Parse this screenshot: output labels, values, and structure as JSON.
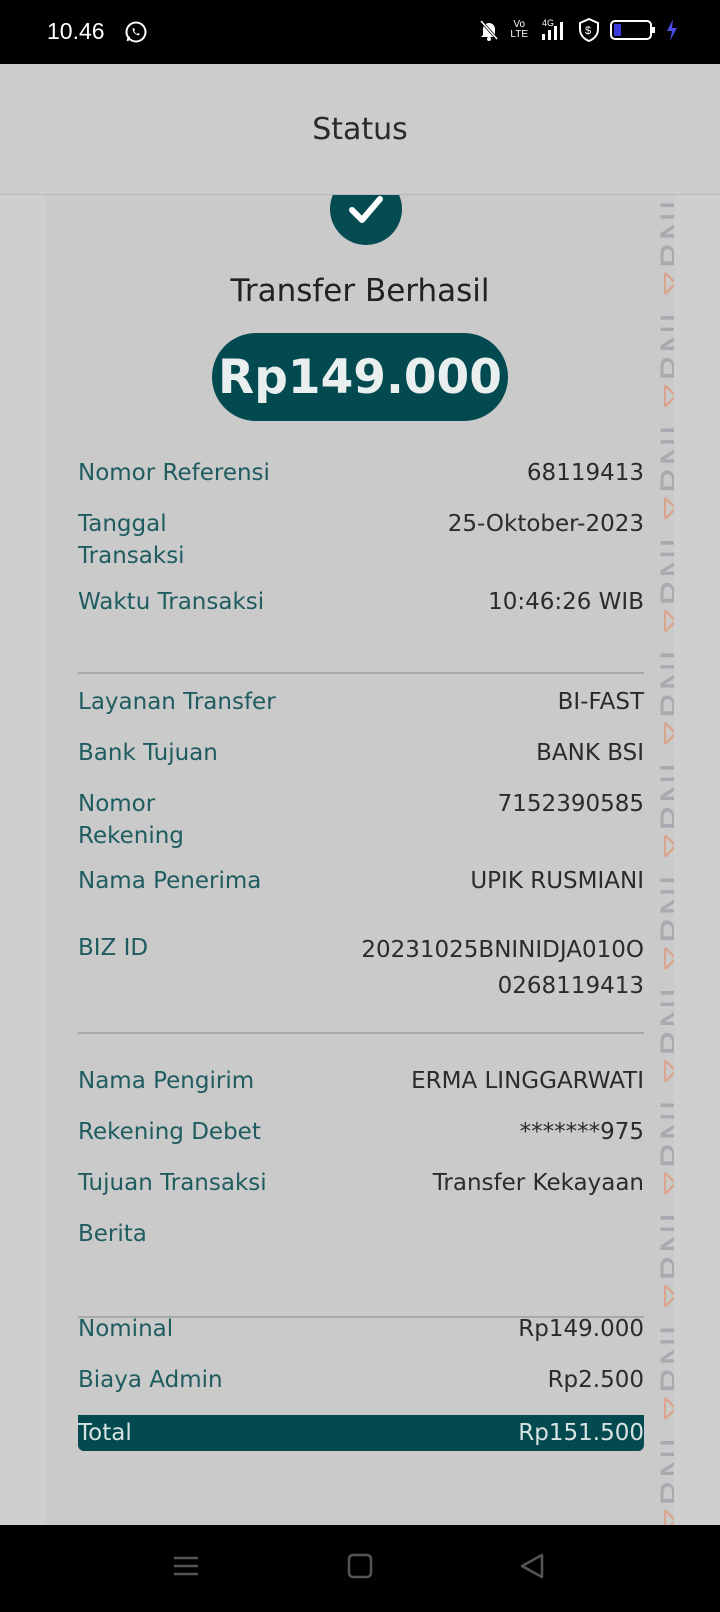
{
  "status_bar": {
    "time": "10.46",
    "icons": [
      "whatsapp-icon",
      "mute-icon",
      "volte-icon",
      "signal-4g-icon",
      "vpn-shield-icon",
      "battery-icon",
      "charging-icon"
    ],
    "volte_text": "Vo\nLTE",
    "network_text": "4G"
  },
  "header": {
    "title": "Status"
  },
  "receipt": {
    "status_title": "Transfer Berhasil",
    "amount": "Rp149.000",
    "watermark_text": "BNI",
    "section1": [
      {
        "label": "Nomor Referensi",
        "value": "68119413"
      },
      {
        "label": "Tanggal Transaksi",
        "value": "25-Oktober-2023"
      },
      {
        "label": "Waktu Transaksi",
        "value": "10:46:26 WIB"
      }
    ],
    "section2": [
      {
        "label": "Layanan Transfer",
        "value": "BI-FAST"
      },
      {
        "label": "Bank Tujuan",
        "value": "BANK BSI"
      },
      {
        "label": "Nomor Rekening",
        "value": "7152390585"
      },
      {
        "label": "Nama Penerima",
        "value": "UPIK RUSMIANI"
      },
      {
        "label": "BIZ ID",
        "value": "20231025BNINIDJA010O0268119413"
      }
    ],
    "section3": [
      {
        "label": "Nama Pengirim",
        "value": "ERMA LINGGARWATI"
      },
      {
        "label": "Rekening Debet",
        "value": "*******975"
      },
      {
        "label": "Tujuan Transaksi",
        "value": "Transfer Kekayaan"
      },
      {
        "label": "Berita",
        "value": ""
      }
    ],
    "section4": [
      {
        "label": "Nominal",
        "value": "Rp149.000"
      },
      {
        "label": "Biaya Admin",
        "value": "Rp2.500"
      }
    ],
    "total": {
      "label": "Total",
      "value": "Rp151.500"
    }
  },
  "nav": {
    "icons": [
      "menu-icon",
      "home-icon",
      "back-icon"
    ]
  },
  "colors": {
    "primary": "#034a50",
    "label": "#1e5c60",
    "watermark_accent": "#d9a58e"
  }
}
